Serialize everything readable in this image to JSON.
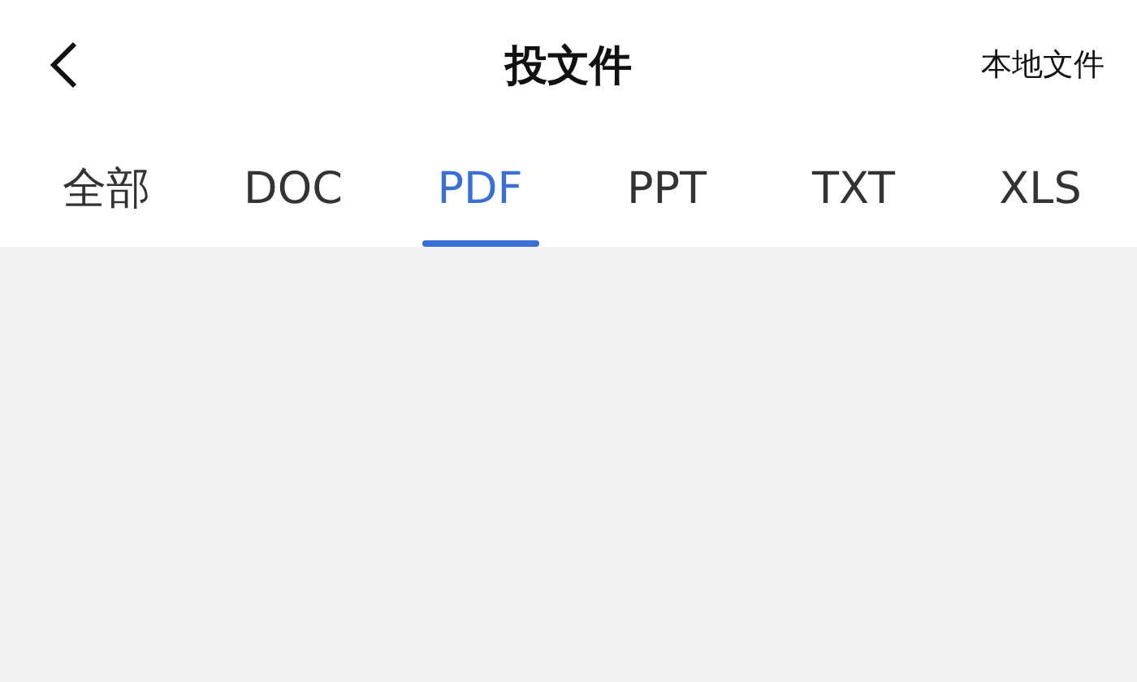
{
  "header": {
    "title": "投文件",
    "action": "本地文件"
  },
  "tabs": [
    {
      "label": "全部",
      "selected": false
    },
    {
      "label": "DOC",
      "selected": false
    },
    {
      "label": "PDF",
      "selected": true
    },
    {
      "label": "PPT",
      "selected": false
    },
    {
      "label": "TXT",
      "selected": false
    },
    {
      "label": "XLS",
      "selected": false
    }
  ]
}
